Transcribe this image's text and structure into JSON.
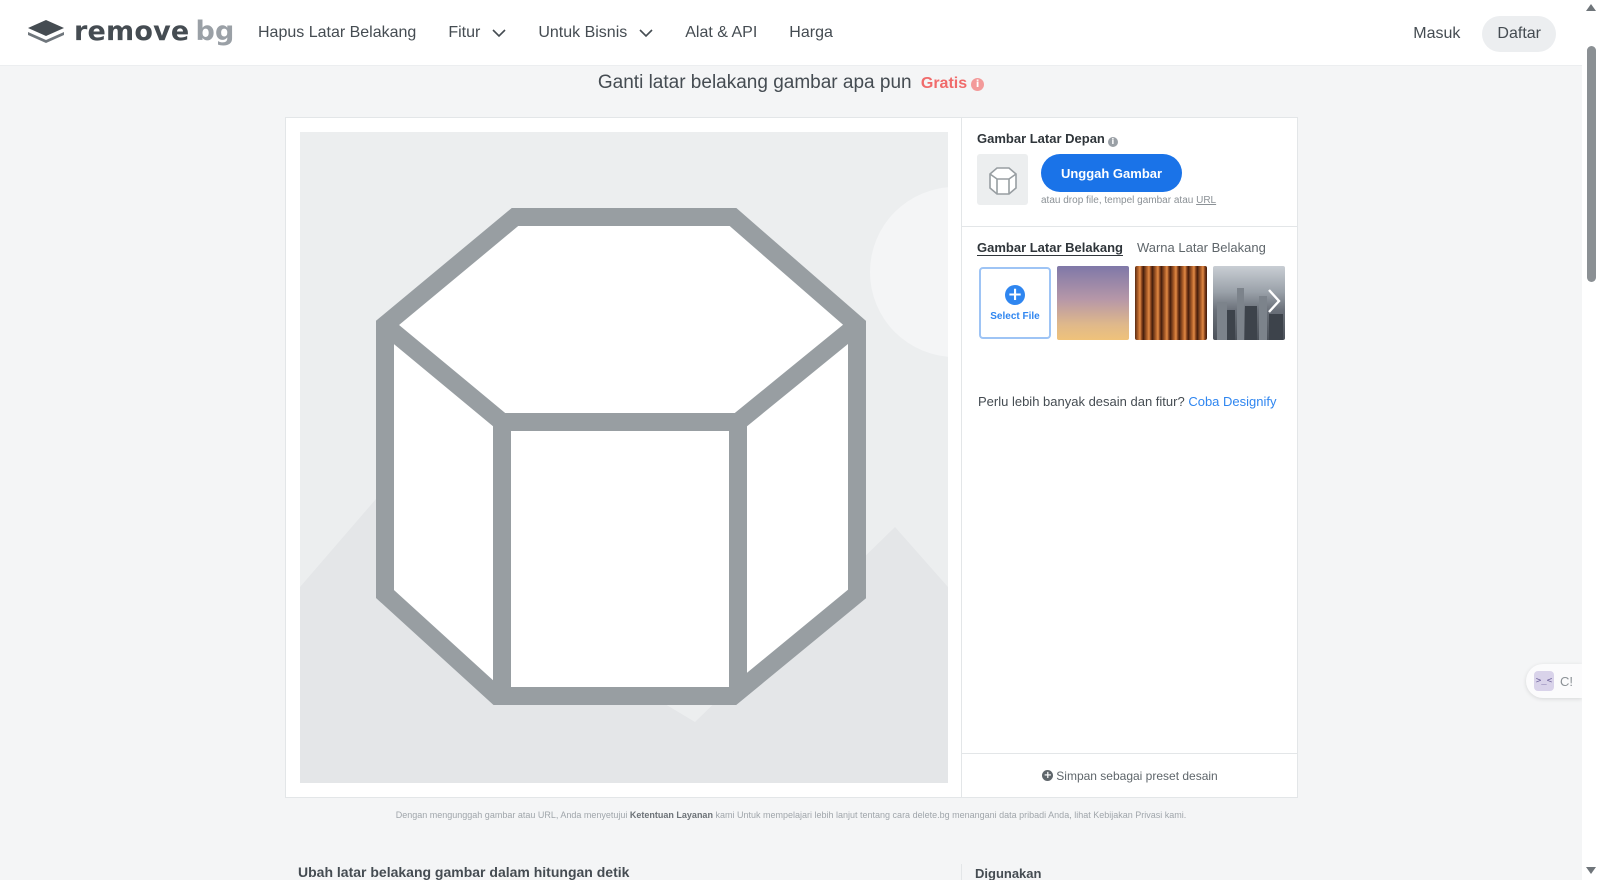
{
  "header": {
    "logo_remove": "remove",
    "logo_bg": "bg",
    "nav": [
      {
        "label": "Hapus Latar Belakang"
      },
      {
        "label": "Fitur"
      },
      {
        "label": "Untuk Bisnis"
      },
      {
        "label": "Alat & API"
      },
      {
        "label": "Harga"
      }
    ],
    "login": "Masuk",
    "signup": "Daftar"
  },
  "headline": {
    "text": "Ganti latar belakang gambar apa pun",
    "free": "Gratis"
  },
  "editor": {
    "foreground_title": "Gambar Latar Depan",
    "upload_button": "Unggah Gambar",
    "upload_hint": "atau drop file, tempel gambar atau",
    "upload_hint_url": "URL",
    "tab_background_image": "Gambar Latar Belakang",
    "tab_background_color": "Warna Latar Belakang",
    "select_file": "Select File",
    "designify_prompt": "Perlu lebih banyak desain dan fitur?",
    "designify_link": "Coba Designify",
    "save_preset": "Simpan sebagai preset desain"
  },
  "terms": {
    "before": "Dengan mengunggah gambar atau URL, Anda menyetujui",
    "link": "Ketentuan Layanan",
    "after": "kami Untuk mempelajari lebih lanjut tentang cara delete.bg menangani data pribadi Anda, lihat Kebijakan Privasi kami."
  },
  "bottom": {
    "left_heading": "Ubah latar belakang gambar dalam hitungan detik",
    "right_heading": "Digunakan"
  },
  "widget": {
    "icon_text": ">_<",
    "label": "C!"
  },
  "colors": {
    "accent_blue": "#1a73e8",
    "free_red": "#f06b6b",
    "hexagon_gray": "#989ea2"
  }
}
